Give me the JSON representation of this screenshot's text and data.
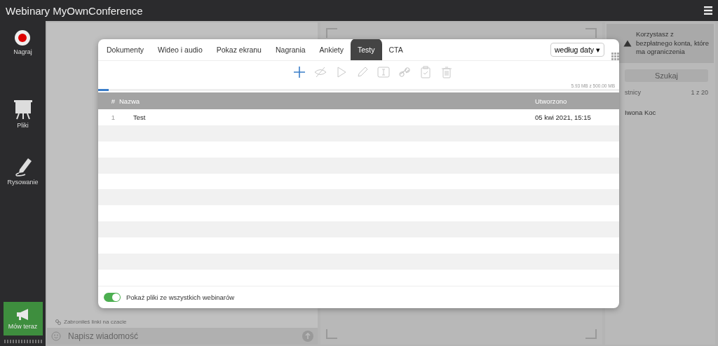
{
  "window": {
    "title": "Webinary MyOwnConference"
  },
  "sidebar": {
    "items": [
      {
        "kind": "record",
        "label": "Nagraj"
      },
      {
        "kind": "files",
        "label": "Pliki"
      },
      {
        "kind": "draw",
        "label": "Rysowanie"
      }
    ],
    "speak_button": "Mów teraz"
  },
  "chat": {
    "notice": "Zabroniłeś linki na czacie",
    "placeholder": "Napisz wiadomość"
  },
  "right_panel": {
    "warning": "Korzystasz z bezpłatnego konta, które ma ograniczenia",
    "search_button": "Szukaj",
    "participants_label": "stnicy",
    "participants_count": "1 z 20",
    "participants": [
      "Iwona Koc"
    ]
  },
  "dialog": {
    "tabs": [
      {
        "label": "Dokumenty",
        "selected": false
      },
      {
        "label": "Wideo i audio",
        "selected": false
      },
      {
        "label": "Pokaz ekranu",
        "selected": false
      },
      {
        "label": "Nagrania",
        "selected": false
      },
      {
        "label": "Ankiety",
        "selected": false
      },
      {
        "label": "Testy",
        "selected": true
      },
      {
        "label": "CTA",
        "selected": false
      }
    ],
    "sort": "według daty ▾",
    "toolbar": [
      {
        "kind": "add",
        "disabled": false
      },
      {
        "kind": "hide",
        "disabled": true
      },
      {
        "kind": "play",
        "disabled": true
      },
      {
        "kind": "edit",
        "disabled": true
      },
      {
        "kind": "rename",
        "disabled": true
      },
      {
        "kind": "link",
        "disabled": true
      },
      {
        "kind": "results",
        "disabled": true
      },
      {
        "kind": "delete",
        "disabled": true
      }
    ],
    "storage": {
      "text": "5.93 MB z 500.00 MB",
      "level": 0.02
    },
    "table": {
      "columns": [
        "#",
        "Nazwa",
        "Utworzono"
      ],
      "rows": [
        [
          "1",
          "Test",
          "05 kwi 2021, 15:15"
        ]
      ]
    },
    "show_all": {
      "label": "Pokaż pliki ze wszystkich webinarów",
      "on": true
    }
  }
}
